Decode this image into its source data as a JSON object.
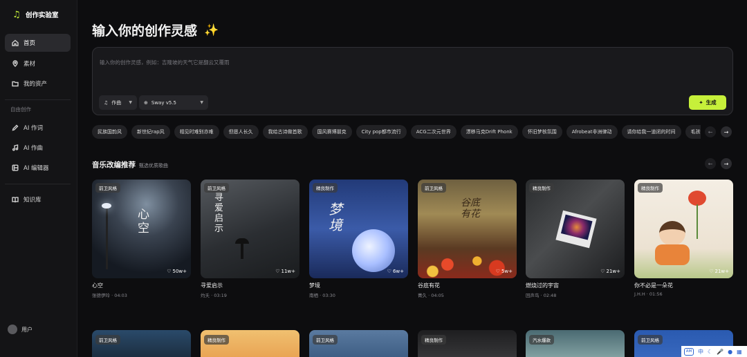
{
  "brand": {
    "name": "创作实验室",
    "icon": "music-note-icon",
    "accent": "#c6f03a"
  },
  "sidebar": {
    "items": [
      {
        "label": "首页",
        "icon": "home-icon",
        "active": true
      },
      {
        "label": "素材",
        "icon": "location-pin-icon"
      },
      {
        "label": "我的资产",
        "icon": "folder-icon"
      }
    ],
    "section_label": "自由创作",
    "create_items": [
      {
        "label": "AI 作词",
        "icon": "pen-icon"
      },
      {
        "label": "AI 作曲",
        "icon": "music-icon"
      },
      {
        "label": "AI 编辑器",
        "icon": "editor-icon"
      }
    ],
    "knowledge": {
      "label": "知识库",
      "icon": "book-icon"
    },
    "user": {
      "label": "用户"
    }
  },
  "hero": {
    "title": "输入你的创作灵感",
    "sparkle": "✨"
  },
  "prompt": {
    "placeholder": "输入你的创作灵感，例如：吉隆坡的天气它是翻云又覆雨",
    "mode_select": "作曲",
    "model_select": "Sway v5.5",
    "generate_label": "生成"
  },
  "chips": [
    "民族国韵风",
    "新世纪rap风",
    "相见时难别亦难",
    "但愿人长久",
    "我给古诗做首歌",
    "国风赛博朋克",
    "City pop都市流行",
    "ACG二次元世界",
    "漂移马克Drift Phonk",
    "怀旧梦核氛围",
    "Afrobeat非洲律动",
    "请你给我一道闭的时间",
    "毛孩子陪我宅"
  ],
  "section": {
    "title": "音乐改编推荐",
    "subtitle": "甄选优质歌曲"
  },
  "cards": [
    {
      "tag": "前卫风格",
      "likes": "50w+",
      "name": "心空",
      "meta": "张德伊玲 · 04:03",
      "art": "心\n空"
    },
    {
      "tag": "前卫风格",
      "likes": "11w+",
      "name": "寻爱启示",
      "meta": "灼夭 · 03:19",
      "art": "寻\n爱\n启\n示"
    },
    {
      "tag": "精良制作",
      "likes": "6w+",
      "name": "梦境",
      "meta": "南栖 · 03:30",
      "art": "梦\n境"
    },
    {
      "tag": "前卫风格",
      "likes": "5w+",
      "name": "谷底有花",
      "meta": "菁久 · 04:05",
      "art": "谷底\n有花"
    },
    {
      "tag": "精良制作",
      "likes": "21w+",
      "name": "燃烧过的宇宙",
      "meta": "回声鸟 · 02:48",
      "art": ""
    },
    {
      "tag": "精良制作",
      "likes": "21w+",
      "name": "你不必是一朵花",
      "meta": "J.H.H · 01:56",
      "art": ""
    }
  ],
  "second_row_tags": [
    "前卫风格",
    "精良制作",
    "前卫风格",
    "精良制作",
    "汽水爆款",
    "前卫风格"
  ],
  "float_tools": {
    "lang": "中"
  }
}
